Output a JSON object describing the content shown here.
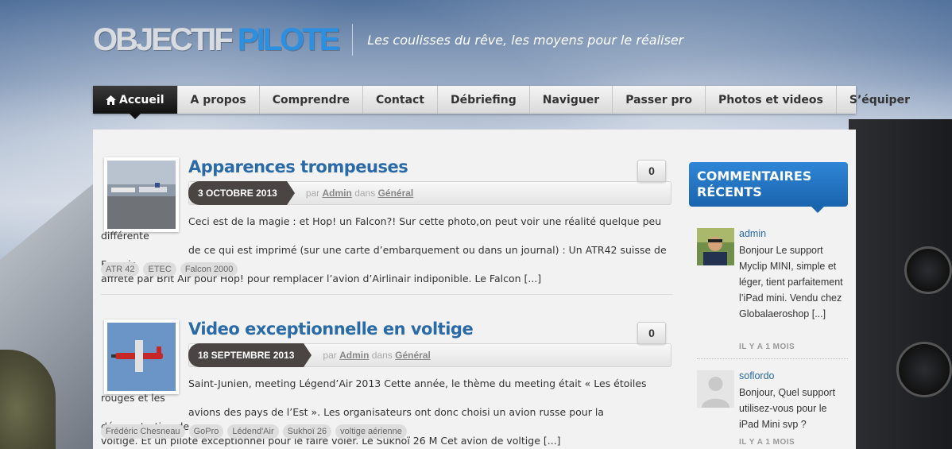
{
  "site": {
    "logo_part1": "OBJECTIF",
    "logo_part2": "PILOTE",
    "tagline": "Les coulisses du rêve, les moyens pour le réaliser"
  },
  "nav": {
    "items": [
      {
        "label": "Accueil",
        "active": true
      },
      {
        "label": "A propos"
      },
      {
        "label": "Comprendre"
      },
      {
        "label": "Contact"
      },
      {
        "label": "Débriefing"
      },
      {
        "label": "Naviguer"
      },
      {
        "label": "Passer pro"
      },
      {
        "label": "Photos et videos"
      },
      {
        "label": "S’équiper"
      }
    ]
  },
  "posts": [
    {
      "title": "Apparences trompeuses",
      "date": "3 OCTOBRE 2013",
      "by": "par",
      "author": "Admin",
      "in": "dans",
      "category": "Général",
      "comments": "0",
      "excerpt_line1": "Ceci est de la magie : et Hop! un Falcon?! Sur cette photo,on peut voir une réalité quelque peu différente",
      "excerpt_line2": "de ce qui est imprimé (sur une carte d’embarquement ou dans un journal) : Un  ATR42 suisse de Farnair",
      "excerpt_line3": "affrété par Brit Air pour Hop! pour remplacer l’avion d’Airlinair indiponible. Le Falcon [...]",
      "tags": [
        "ATR 42",
        "ETEC",
        "Falcon 2000"
      ]
    },
    {
      "title": "Video exceptionnelle en voltige",
      "date": "18 SEPTEMBRE 2013",
      "by": "par",
      "author": "Admin",
      "in": "dans",
      "category": "Général",
      "comments": "0",
      "excerpt_line1": "Saint-Junien, meeting Légend’Air 2013 Cette année, le thème du meeting était « Les étoiles rouges et les",
      "excerpt_line2": "avions des pays de l’Est ». Les organisateurs ont donc choisi un avion russe pour la démonstration de",
      "excerpt_line3": "voltige. Et un pilote exceptionnel pour le faire voler. Le Sukhoï 26 M Cet avion de voltige [...]",
      "tags": [
        "Frédéric Chesneau",
        "GoPro",
        "Lédend'Air",
        "Sukhoï 26",
        "voltige aérienne"
      ]
    }
  ],
  "sidebar": {
    "widget_title_line1": "COMMENTAIRES",
    "widget_title_line2": "RÉCENTS",
    "comments": [
      {
        "author": "admin",
        "text": "Bonjour Le support Myclip MINI, simple et léger, tient parfaitement l’iPad mini. Vendu chez Globalaeroshop [...]",
        "time": "IL Y A 1 MOIS"
      },
      {
        "author": "soflordo",
        "text": "Bonjour, Quel support utilisez-vous pour le iPad Mini svp ?",
        "time": "IL Y A 1 MOIS"
      }
    ]
  },
  "colors": {
    "accent": "#2a6aa6",
    "logo_blue": "#2d8fe0",
    "date_badge": "#4a4442",
    "widget_blue": "#1a64ae"
  }
}
